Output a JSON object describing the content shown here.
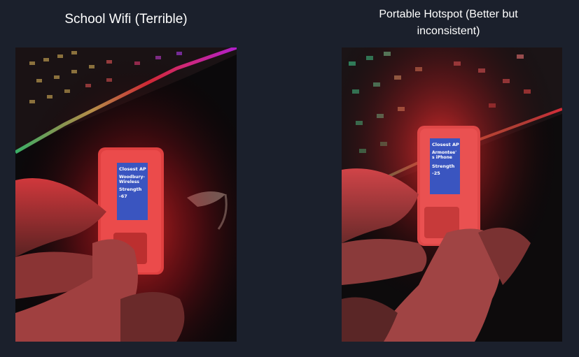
{
  "panels": [
    {
      "caption": "School Wifi (Terrible)",
      "device_screen": {
        "heading": "Closest AP",
        "ssid_line1": "Woodbury-",
        "ssid_line2": "Wireless",
        "strength_label": "Strength",
        "strength_value": "-67"
      }
    },
    {
      "caption_line1": "Portable Hotspot (Better but",
      "caption_line2": "inconsistent)",
      "device_screen": {
        "heading": "Closest AP",
        "ssid_line1": "Armontee'",
        "ssid_line2": "s iPhone",
        "strength_label": "Strength",
        "strength_value": "-25"
      }
    }
  ],
  "colors": {
    "page_background": "#1b202c",
    "caption_text": "#ffffff",
    "device_screen": "#3a55c0",
    "device_glow": "#ff2020"
  }
}
